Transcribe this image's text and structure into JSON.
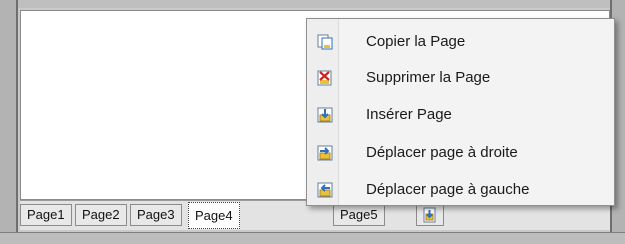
{
  "tabs": [
    {
      "label": "Page1"
    },
    {
      "label": "Page2"
    },
    {
      "label": "Page3"
    },
    {
      "label": "Page4"
    },
    {
      "label": "Page5"
    }
  ],
  "active_tab": "Page4",
  "context_menu": {
    "items": [
      {
        "label": "Copier la Page",
        "icon": "copy-page-icon"
      },
      {
        "label": "Supprimer la Page",
        "icon": "delete-page-icon"
      },
      {
        "label": "Insérer Page",
        "icon": "insert-page-icon"
      },
      {
        "label": "Déplacer page à droite",
        "icon": "move-right-icon"
      },
      {
        "label": "Déplacer page à gauche",
        "icon": "move-left-icon"
      }
    ]
  },
  "colors": {
    "menu_background": "#f3f3f3",
    "icon_blue": "#2f6fc0",
    "icon_red": "#d02020",
    "icon_yellow": "#e8c23a"
  }
}
